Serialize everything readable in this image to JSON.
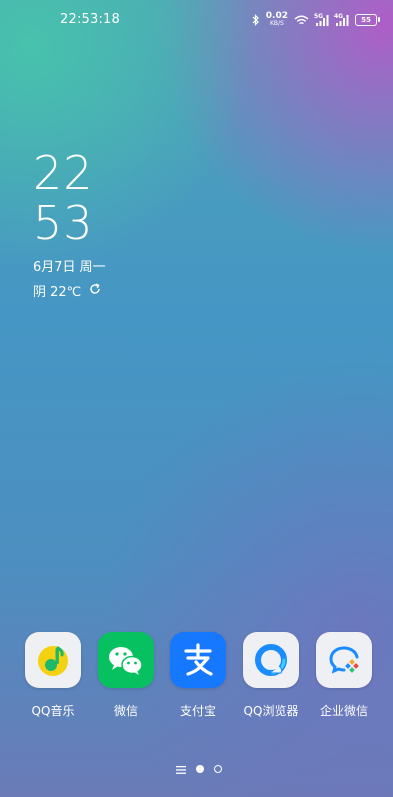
{
  "status_bar": {
    "time": "22:53:18",
    "net_speed_value": "0.02",
    "net_speed_unit": "KB/S",
    "sim1_type": "5G",
    "sim2_type": "4G",
    "battery_level": "55"
  },
  "clock_widget": {
    "hour": "22",
    "minute": "53",
    "date": "6月7日 周一",
    "weather": "阴 22℃"
  },
  "dock": {
    "apps": [
      {
        "label": "QQ音乐",
        "icon": "qq-music-icon"
      },
      {
        "label": "微信",
        "icon": "wechat-icon"
      },
      {
        "label": "支付宝",
        "icon": "alipay-icon"
      },
      {
        "label": "QQ浏览器",
        "icon": "qq-browser-icon"
      },
      {
        "label": "企业微信",
        "icon": "wecom-icon"
      }
    ]
  },
  "colors": {
    "wechat_green": "#07c160",
    "alipay_blue": "#1677ff",
    "qq_music_yellow": "#f5d211"
  }
}
